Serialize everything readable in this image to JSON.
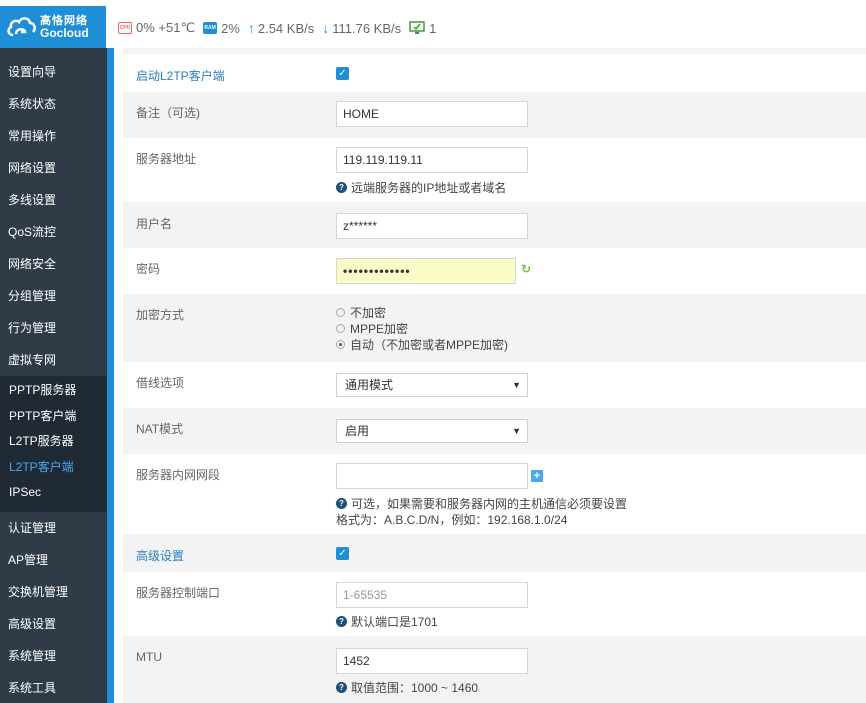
{
  "header": {
    "logo_cn": "高恪网络",
    "logo_en": "Gocloud",
    "cpu_chip": "CPU",
    "cpu_text": "0% +51℃",
    "ram_chip": "RAM",
    "ram_text": "2%",
    "upload": "2.54 KB/s",
    "download": "111.76 KB/s",
    "devices": "1"
  },
  "sidebar": {
    "items_top": [
      "设置向导",
      "系统状态",
      "常用操作",
      "网络设置",
      "多线设置",
      "QoS流控",
      "网络安全",
      "分组管理",
      "行为管理",
      "虚拟专网"
    ],
    "sub_items": [
      "PPTP服务器",
      "PPTP客户端",
      "L2TP服务器",
      "L2TP客户端",
      "IPSec"
    ],
    "active_sub": "L2TP客户端",
    "items_bottom": [
      "认证管理",
      "AP管理",
      "交换机管理",
      "高级设置",
      "系统管理",
      "系统工具"
    ]
  },
  "form": {
    "enable_label": "启动L2TP客户端",
    "enable_checked": true,
    "note_label": "备注（可选)",
    "note_value": "HOME",
    "server_label": "服务器地址",
    "server_value": "119.119.119.11",
    "server_help": "远端服务器的IP地址或者域名",
    "user_label": "用户名",
    "user_value": "z******",
    "password_label": "密码",
    "password_value": "•••••••••••••",
    "encrypt_label": "加密方式",
    "encrypt_options": [
      "不加密",
      "MPPE加密",
      "自动（不加密或者MPPE加密)"
    ],
    "encrypt_selected": 2,
    "borrow_label": "借线选项",
    "borrow_value": "通用模式",
    "nat_label": "NAT模式",
    "nat_value": "启用",
    "subnet_label": "服务器内网网段",
    "subnet_value": "",
    "subnet_help": "可选，如果需要和服务器内网的主机通信必须要设置",
    "subnet_format": "格式为：A.B.C.D/N，例如：192.168.1.0/24",
    "advanced_label": "高级设置",
    "advanced_checked": true,
    "port_label": "服务器控制端口",
    "port_placeholder": "1-65535",
    "port_help": "默认端口是1701",
    "mtu_label": "MTU",
    "mtu_value": "1452",
    "mtu_help": "取值范围：1000 ~ 1460"
  },
  "colors": {
    "brand": "#1e8fd6",
    "sidebar_bg": "#2f3b47",
    "sidebar_sub_bg": "#1f2a35",
    "active_text": "#4aa8f0",
    "password_bg": "#fbfbc7"
  }
}
